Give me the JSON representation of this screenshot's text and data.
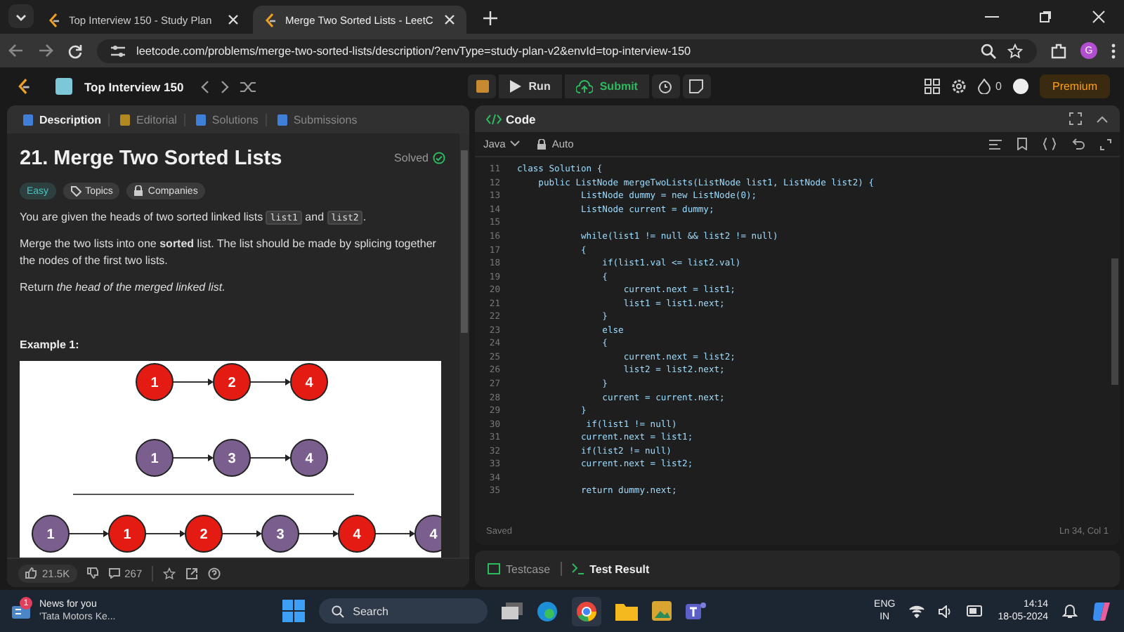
{
  "browser": {
    "tabs": [
      {
        "title": "Top Interview 150 - Study Plan",
        "selected": false
      },
      {
        "title": "Merge Two Sorted Lists - LeetC",
        "selected": true
      }
    ],
    "url": "leetcode.com/problems/merge-two-sorted-lists/description/?envType=study-plan-v2&envId=top-interview-150",
    "profile": "G"
  },
  "nav": {
    "title": "Top Interview 150",
    "run": "Run",
    "submit": "Submit",
    "coins": "0",
    "premium": "Premium"
  },
  "problem": {
    "tabs": [
      {
        "label": "Description",
        "selected": true
      },
      {
        "label": "Editorial",
        "selected": false
      },
      {
        "label": "Solutions",
        "selected": false
      },
      {
        "label": "Submissions",
        "selected": false
      }
    ],
    "title": "21. Merge Two Sorted Lists",
    "status": "Solved",
    "tags": [
      {
        "label": "Easy",
        "kind": "difficulty"
      },
      {
        "label": "Topics",
        "kind": "topics"
      },
      {
        "label": "Companies",
        "kind": "companies"
      }
    ],
    "paragraphs": [
      {
        "segments": [
          {
            "text": "You are given the heads of two sorted linked lists ",
            "kind": "text"
          },
          {
            "text": "list1",
            "kind": "code"
          },
          {
            "text": " and ",
            "kind": "text"
          },
          {
            "text": "list2",
            "kind": "code"
          },
          {
            "text": ".",
            "kind": "text"
          }
        ]
      },
      {
        "segments": [
          {
            "text": "Merge the two lists into one **sorted** list. The list should be made by splicing together the nodes of the first two lists.",
            "kind": "text"
          }
        ]
      },
      {
        "segments": [
          {
            "text": "Return *the head of the merged linked list.*",
            "kind": "text"
          }
        ]
      }
    ],
    "example_title": "Example 1:",
    "diagram": {
      "rows": [
        {
          "nodes": [
            {
              "label": "1",
              "color": "#e31b12"
            },
            {
              "label": "2",
              "color": "#e31b12"
            },
            {
              "label": "4",
              "color": "#e31b12"
            }
          ]
        },
        {
          "nodes": [
            {
              "label": "1",
              "color": "#7a5f8e"
            },
            {
              "label": "3",
              "color": "#7a5f8e"
            },
            {
              "label": "4",
              "color": "#7a5f8e"
            }
          ]
        },
        {
          "nodes": [
            {
              "label": "1",
              "color": "#7a5f8e"
            },
            {
              "label": "1",
              "color": "#e31b12"
            },
            {
              "label": "2",
              "color": "#e31b12"
            },
            {
              "label": "3",
              "color": "#7a5f8e"
            },
            {
              "label": "4",
              "color": "#e31b12"
            },
            {
              "label": "4",
              "color": "#7a5f8e"
            }
          ]
        }
      ]
    },
    "likes": "21.5K",
    "comments": "267"
  },
  "editor": {
    "title": "Code",
    "language": "Java",
    "mode": "Auto",
    "lines": [
      {
        "num": "11",
        "code": "class Solution {"
      },
      {
        "num": "12",
        "code": "    public ListNode mergeTwoLists(ListNode list1, ListNode list2) {"
      },
      {
        "num": "13",
        "code": "            ListNode dummy = new ListNode(0);"
      },
      {
        "num": "14",
        "code": "            ListNode current = dummy;"
      },
      {
        "num": "15"
      },
      {
        "num": "16",
        "code": "            while(list1 != null && list2 != null)"
      },
      {
        "num": "17",
        "code": "            {"
      },
      {
        "num": "18",
        "code": "                if(list1.val <= list2.val)"
      },
      {
        "num": "19",
        "code": "                {"
      },
      {
        "num": "20",
        "code": "                    current.next = list1;"
      },
      {
        "num": "21",
        "code": "                    list1 = list1.next;"
      },
      {
        "num": "22",
        "code": "                }"
      },
      {
        "num": "23",
        "code": "                else"
      },
      {
        "num": "24",
        "code": "                {"
      },
      {
        "num": "25",
        "code": "                    current.next = list2;"
      },
      {
        "num": "26",
        "code": "                    list2 = list2.next;"
      },
      {
        "num": "27",
        "code": "                }"
      },
      {
        "num": "28",
        "code": "                current = current.next;"
      },
      {
        "num": "29",
        "code": "            }"
      },
      {
        "num": "30",
        "code": "             if(list1 != null)"
      },
      {
        "num": "31",
        "code": "            current.next = list1;"
      },
      {
        "num": "32",
        "code": "            if(list2 != null)"
      },
      {
        "num": "33",
        "code": "            current.next = list2;"
      },
      {
        "num": "34"
      },
      {
        "num": "35",
        "code": "            return dummy.next;"
      }
    ],
    "status": "Saved",
    "cursor": "Ln 34, Col 1"
  },
  "results": {
    "tabs": [
      {
        "label": "Testcase",
        "selected": false
      },
      {
        "label": "Test Result",
        "selected": true
      }
    ]
  },
  "taskbar": {
    "news_title": "News for you",
    "news_subtitle": "'Tata Motors Ke...",
    "badge": "1",
    "search": "Search",
    "lang": "ENG",
    "region": "IN",
    "time": "14:14",
    "date": "18-05-2024"
  }
}
